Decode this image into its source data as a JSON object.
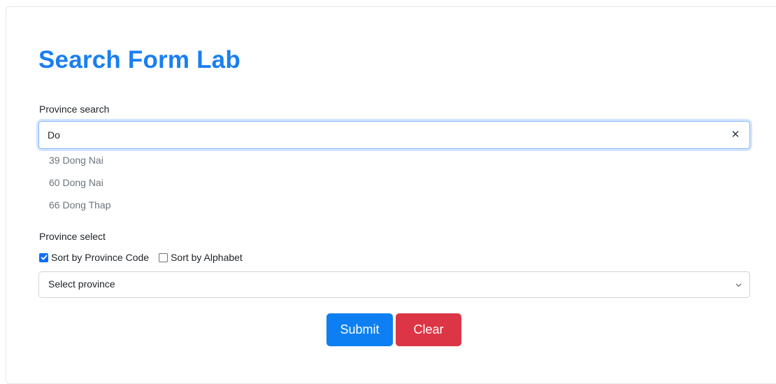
{
  "title": "Search Form Lab",
  "search": {
    "label": "Province search",
    "value": "Do",
    "clear_symbol": "✕",
    "suggestions": [
      "39 Dong Nai",
      "60 Dong Nai",
      "66 Dong Thap"
    ]
  },
  "select_section": {
    "label": "Province select",
    "sort_options": [
      {
        "label": "Sort by Province Code",
        "checked": true
      },
      {
        "label": "Sort by Alphabet",
        "checked": false
      }
    ],
    "selected_value": "Select province"
  },
  "buttons": {
    "submit": "Submit",
    "clear": "Clear"
  },
  "colors": {
    "title": "#1a7ff0",
    "primary": "#0d7ff2",
    "danger": "#dc3545"
  }
}
